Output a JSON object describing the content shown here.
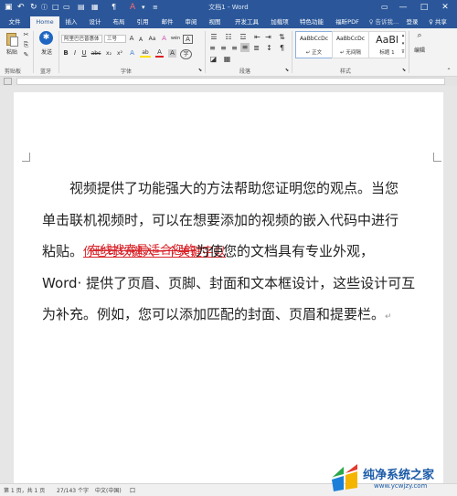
{
  "window": {
    "title": "文档1 - Word",
    "min": "—",
    "max": "□",
    "close": "✕"
  },
  "tabs": [
    "文件",
    "Home",
    "插入",
    "设计",
    "布局",
    "引用",
    "邮件",
    "审阅",
    "视图",
    "开发工具",
    "加载项",
    "特色功能",
    "福昕PDF"
  ],
  "tell_me": "♀ 告诉我...",
  "account": {
    "login": "登录",
    "share": "♀ 共享"
  },
  "ribbon": {
    "clipboard": {
      "paste": "粘贴",
      "label": "剪贴板"
    },
    "bluetooth": {
      "send": "发送",
      "label": "蓝牙"
    },
    "font": {
      "family": "阿里巴巴普惠体",
      "size": "三号",
      "grow": "A",
      "shrink": "A",
      "case": "Aa",
      "clear": "A",
      "phonetic": "wén",
      "char_border": "A",
      "bold": "B",
      "italic": "I",
      "underline": "U",
      "strike": "abc",
      "sub": "x₂",
      "sup": "x²",
      "effects": "A",
      "highlight": "ab",
      "color": "A",
      "shade": "A",
      "enclose": "字",
      "label": "字体"
    },
    "paragraph": {
      "label": "段落"
    },
    "styles": {
      "items": [
        {
          "sample": "AaBbCcDc",
          "name": "↵ 正文"
        },
        {
          "sample": "AaBbCcDc",
          "name": "↵ 无间隔"
        },
        {
          "sample": "AaBl",
          "name": "标题 1"
        }
      ],
      "label": "样式"
    },
    "editing": {
      "label": "编辑"
    }
  },
  "document": {
    "line1": "视频提供了功能强大的方法帮助您证明您的观点。当您",
    "line2": "单击联机视频时，可以在想要添加的视频的嵌入代码中进行",
    "line3_a": "粘贴。",
    "line3_inserted": "你也可以键入一个关键字以",
    "line3_deleted": "在线搜索最适合您的",
    "line3_b": "为使您的文档具有专业外观，",
    "line4": "Word· 提供了页眉、页脚、封面和文本框设计，这些设计可互",
    "line5": "为补充。例如，您可以添加匹配的封面、页眉和提要栏。",
    "para_mark": "↵"
  },
  "status": {
    "page": "第 1 页，共 1 页",
    "words": "27/143 个字",
    "lang": "中文(中国)",
    "macro": "囗"
  },
  "watermark": {
    "name": "纯净系统之家",
    "url": "www.ycwjzy.com"
  },
  "colors": {
    "word_blue": "#2b579a",
    "revision_red": "#d8242a",
    "ribbon_bg": "#f3f3f3"
  }
}
